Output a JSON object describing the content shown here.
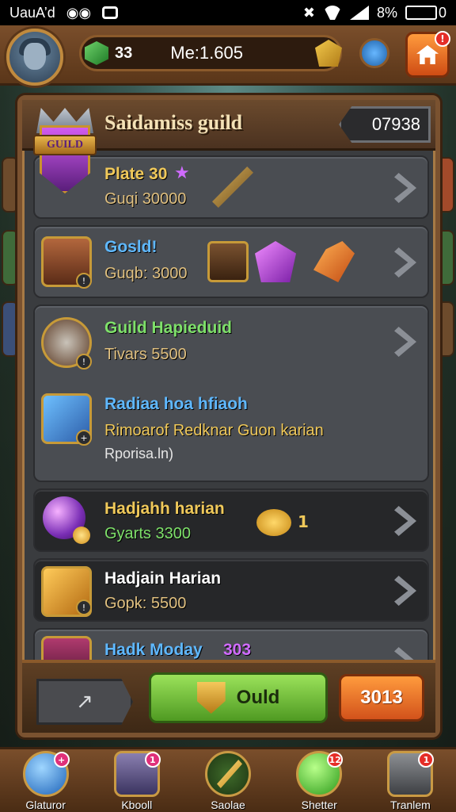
{
  "status_bar": {
    "carrier": "UauA’d",
    "battery": "8%",
    "battery_suffix": "0"
  },
  "top_bar": {
    "gems": "33",
    "member_label": "Me:1.605",
    "icons": [
      "avatar",
      "green-gem-icon",
      "gold-coin-icon",
      "blue-gem-icon",
      "home-icon"
    ],
    "home_badge": "!"
  },
  "panel": {
    "title": "Saidamiss guild",
    "id_value": "07938",
    "emblem_text": "GUILD"
  },
  "guilds": [
    {
      "name": "Plate 30",
      "name_color": "#f0c95a",
      "sub": "Guqi 30000",
      "sub_color": "#e0c080",
      "style": "light",
      "icon": "emblem"
    },
    {
      "name": "Gosld!",
      "name_color": "#5fb8ff",
      "sub": "Guqb: 3000",
      "sub_color": "#e0c080",
      "style": "light",
      "icon": "warrior-portrait-icon",
      "rewards": [
        "hammer-icon",
        "purple-gem-icon",
        "orange-crystal-icon"
      ]
    },
    {
      "name": "Guild Hapieduid",
      "name_color": "#7ee06a",
      "sub": "Tivars 5500",
      "sub_color": "#e0c080",
      "style": "light",
      "icon": "helmet-crest-icon"
    },
    {
      "name": "Radiaa hoa hfiaoh",
      "name_color": "#5fb8ff",
      "sub": "Rimoarof Redknar Guon karian",
      "sub_color": "#f0c95a",
      "extra": "Rporisa.ln)",
      "style": "light",
      "icon": "sword-icon"
    },
    {
      "name": "Hadjahh harian",
      "name_color": "#f0c95a",
      "sub": "Gyarts 3300",
      "sub_color": "#7ee06a",
      "style": "dark",
      "icon": "purple-orb-icon",
      "reward_count": "1"
    },
    {
      "name": "Hadjain Harian",
      "name_color": "#ffffff",
      "sub": "Gopk: 5500",
      "sub_color": "#e0c080",
      "style": "dark",
      "icon": "cannon-icon"
    },
    {
      "name": "Hadk Moday",
      "name_color": "#5fb8ff",
      "name_suffix": "303",
      "name_suffix_color": "#d06bff",
      "style": "light",
      "icon": "warrior-portrait-icon"
    }
  ],
  "actions": {
    "back_label": "↗",
    "join_label": "Ould",
    "cost_label": "3013"
  },
  "bottom_nav": [
    {
      "label": "Glaturor",
      "icon": "blue-orb-icon",
      "badge": "+",
      "badge_color": "#e0307a"
    },
    {
      "label": "Kbooll",
      "icon": "guild-tower-icon",
      "badge": "1",
      "badge_color": "#e0307a"
    },
    {
      "label": "Saolae",
      "icon": "golden-sword-icon",
      "badge": "",
      "badge_color": ""
    },
    {
      "label": "Shetter",
      "icon": "green-orb-icon",
      "badge": "12",
      "badge_color": "#e52d27"
    },
    {
      "label": "Tranlem",
      "icon": "gear-icon",
      "badge": "1",
      "badge_color": "#e52d27"
    }
  ]
}
